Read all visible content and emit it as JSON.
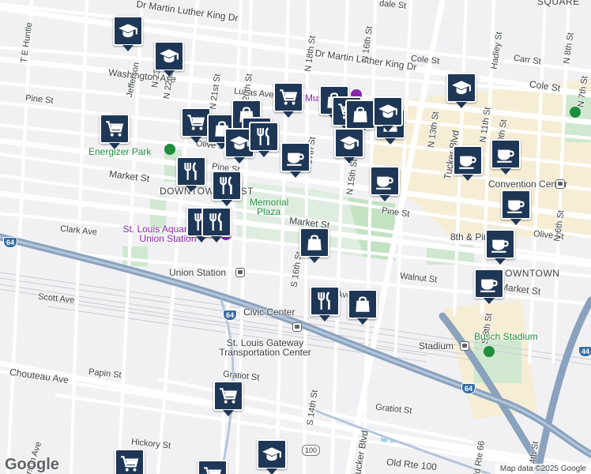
{
  "map": {
    "logo": "Google",
    "attribution": "Map data ©2025 Google",
    "district_labels": {
      "downtown_west": "DOWNTOWN WEST",
      "downtown": "DOWNTOWN",
      "square": "SQUARE"
    },
    "street_labels": {
      "mlk_west": "Dr Martin Luther King Dr",
      "mlk_east": "Dr Martin Luther King Dr",
      "washington_ave": "Washington Ave",
      "lucas_ave": "Lucas Ave",
      "pine_st_w": "Pine St",
      "pine_st_mid": "Pine St",
      "pine_st_e": "Pine St",
      "olive_st_w": "Olive St",
      "olive_st_e": "Olive St",
      "market_st_w": "Market St",
      "market_st_mid": "Market St",
      "market_st_e": "Market St",
      "clark_ave_w": "Clark Ave",
      "clark_ave_mid": "Clark Ave",
      "walnut_st": "Walnut St",
      "scott_ave": "Scott Ave",
      "chouteau_ave": "Chouteau Ave",
      "papin_st": "Papin St",
      "gratiot_st_w": "Gratiot St",
      "gratiot_st_e": "Gratiot St",
      "hickory_st": "Hickory St",
      "old_rte_100": "Old Rte 100",
      "old_rte_66": "Old Rte 66",
      "cole_st_w": "Cole St",
      "cole_st_e": "Cole St",
      "carr_st": "Carr St",
      "tucker_blvd_n": "Tucker Blvd",
      "tucker_blvd_s": "Tucker Blvd",
      "n_20th_st": "N 20th St",
      "n_21st_st": "N 21st St",
      "n_22nd_st": "N 22nd St",
      "n_23rd_st": "N 23rd St",
      "n_18th_st": "N 18th St",
      "n_17th_st": "N 17th St",
      "n_16th_st": "N 16th St",
      "n_15th_st": "N 15th St",
      "n_13th_st": "N 13th St",
      "n_11th_st": "N 11th St",
      "n_10th_st": "N 10th St",
      "n_8th_st": "N 8th St",
      "n_7th_st": "N 7th St",
      "n_6th_st": "N 6th St",
      "s_16th_st": "S 16th St",
      "s_14th_st": "S 14th St",
      "s_8th_st": "S 8th St",
      "s_4th_st": "S 4th St",
      "hadley_st": "Hadley St",
      "jefferson_ave_n": "Jefferson",
      "jefferson_ave_s": "Jefferson Ave",
      "t_e_huntley": "T E Huntle",
      "dale_st": "dale St",
      "eighth_pine": "8th & Pine"
    },
    "poi_labels": {
      "energizer_park": "Energizer Park",
      "memorial_plaza": "Memorial Plaza",
      "aquarium": "St. Louis Aquarium at Union Station",
      "union_station": "Union Station",
      "civic_center": "Civic Center",
      "gateway_transportation": "St. Louis Gateway Transportation Center",
      "convention_center": "Convention Center",
      "stadium": "Stadium",
      "busch_stadium": "Busch Stadium",
      "museum_partial": "Mus"
    },
    "highway_shields": {
      "i64_w": "64",
      "i64_mid": "64",
      "i64_s": "64",
      "i44": "44",
      "rte100": "100"
    },
    "pins": [
      {
        "id": "school-1",
        "icon": "school-icon"
      },
      {
        "id": "school-2",
        "icon": "school-icon"
      },
      {
        "id": "grocery-1",
        "icon": "grocery-cart-icon"
      },
      {
        "id": "grocery-2",
        "icon": "grocery-cart-icon"
      },
      {
        "id": "grocery-3",
        "icon": "grocery-cart-icon"
      },
      {
        "id": "shopping-1",
        "icon": "shopping-bag-icon"
      },
      {
        "id": "shopping-2",
        "icon": "shopping-bag-icon"
      },
      {
        "id": "restaurant-1",
        "icon": "restaurant-icon"
      },
      {
        "id": "school-3",
        "icon": "school-icon"
      },
      {
        "id": "cafe-1",
        "icon": "coffee-cup-icon"
      },
      {
        "id": "shopping-3",
        "icon": "shopping-bag-icon"
      },
      {
        "id": "school-4",
        "icon": "school-icon"
      },
      {
        "id": "grocery-4",
        "icon": "grocery-cart-icon"
      },
      {
        "id": "shopping-4",
        "icon": "shopping-bag-icon"
      },
      {
        "id": "school-5",
        "icon": "school-icon"
      },
      {
        "id": "shopping-5",
        "icon": "shopping-bag-icon"
      },
      {
        "id": "restaurant-2",
        "icon": "restaurant-icon"
      },
      {
        "id": "restaurant-3",
        "icon": "restaurant-icon"
      },
      {
        "id": "restaurant-4",
        "icon": "restaurant-icon"
      },
      {
        "id": "restaurant-5",
        "icon": "restaurant-icon"
      },
      {
        "id": "restaurant-6",
        "icon": "restaurant-icon"
      },
      {
        "id": "cafe-2",
        "icon": "coffee-cup-icon"
      },
      {
        "id": "cafe-3",
        "icon": "coffee-cup-icon"
      },
      {
        "id": "cafe-4",
        "icon": "coffee-cup-icon"
      },
      {
        "id": "cafe-5",
        "icon": "coffee-cup-icon"
      },
      {
        "id": "cafe-6",
        "icon": "coffee-cup-icon"
      },
      {
        "id": "cafe-7",
        "icon": "coffee-cup-icon"
      },
      {
        "id": "shopping-6",
        "icon": "shopping-bag-icon"
      },
      {
        "id": "restaurant-7",
        "icon": "restaurant-icon"
      },
      {
        "id": "shopping-7",
        "icon": "shopping-bag-icon"
      },
      {
        "id": "grocery-5",
        "icon": "grocery-cart-icon"
      },
      {
        "id": "grocery-6",
        "icon": "grocery-cart-icon"
      },
      {
        "id": "school-6",
        "icon": "school-icon"
      },
      {
        "id": "grocery-7",
        "icon": "grocery-cart-icon"
      },
      {
        "id": "school-7",
        "icon": "school-icon"
      }
    ],
    "colors": {
      "pin": "#1f3756",
      "park": "#cfe8cf",
      "highway": "#8aa2bd",
      "downtown_fill": "#f6ecd2",
      "water": "#9fd3ea"
    }
  }
}
